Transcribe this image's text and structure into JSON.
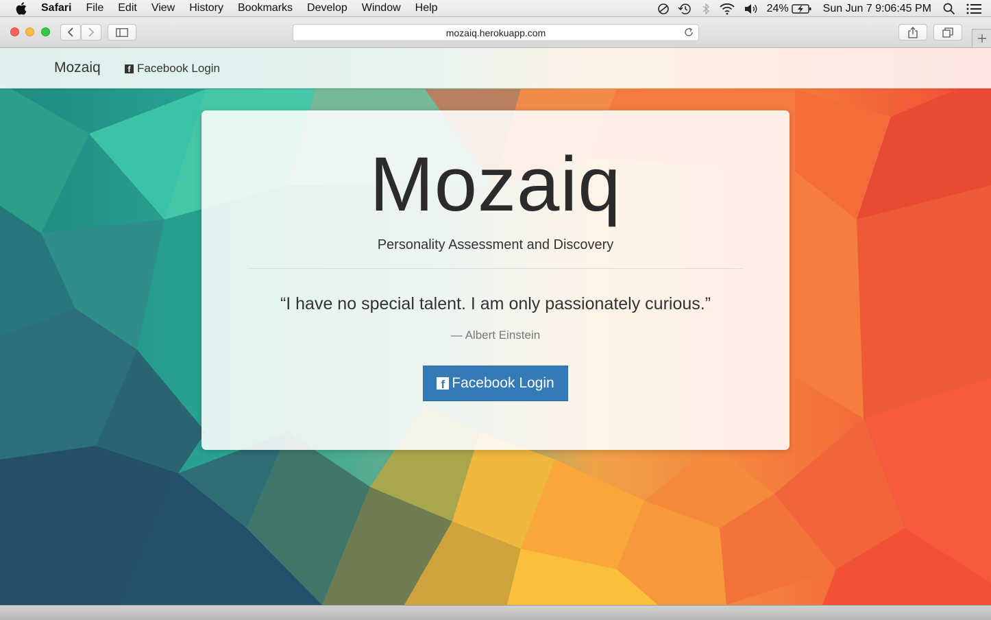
{
  "menubar": {
    "apple_icon": "apple-logo-icon",
    "items": [
      "Safari",
      "File",
      "Edit",
      "View",
      "History",
      "Bookmarks",
      "Develop",
      "Window",
      "Help"
    ],
    "battery_percent": "24%",
    "clock": "Sun Jun 7  9:06:45 PM"
  },
  "browser": {
    "url": "mozaiq.herokuapp.com"
  },
  "navbar": {
    "brand": "Mozaiq",
    "login_label": "Facebook Login"
  },
  "hero": {
    "title": "Mozaiq",
    "subtitle": "Personality Assessment and Discovery",
    "quote": "“I have no special talent. I am only passionately curious.”",
    "author": "— Albert Einstein",
    "button_label": "Facebook Login",
    "button_color": "#337ab7"
  }
}
